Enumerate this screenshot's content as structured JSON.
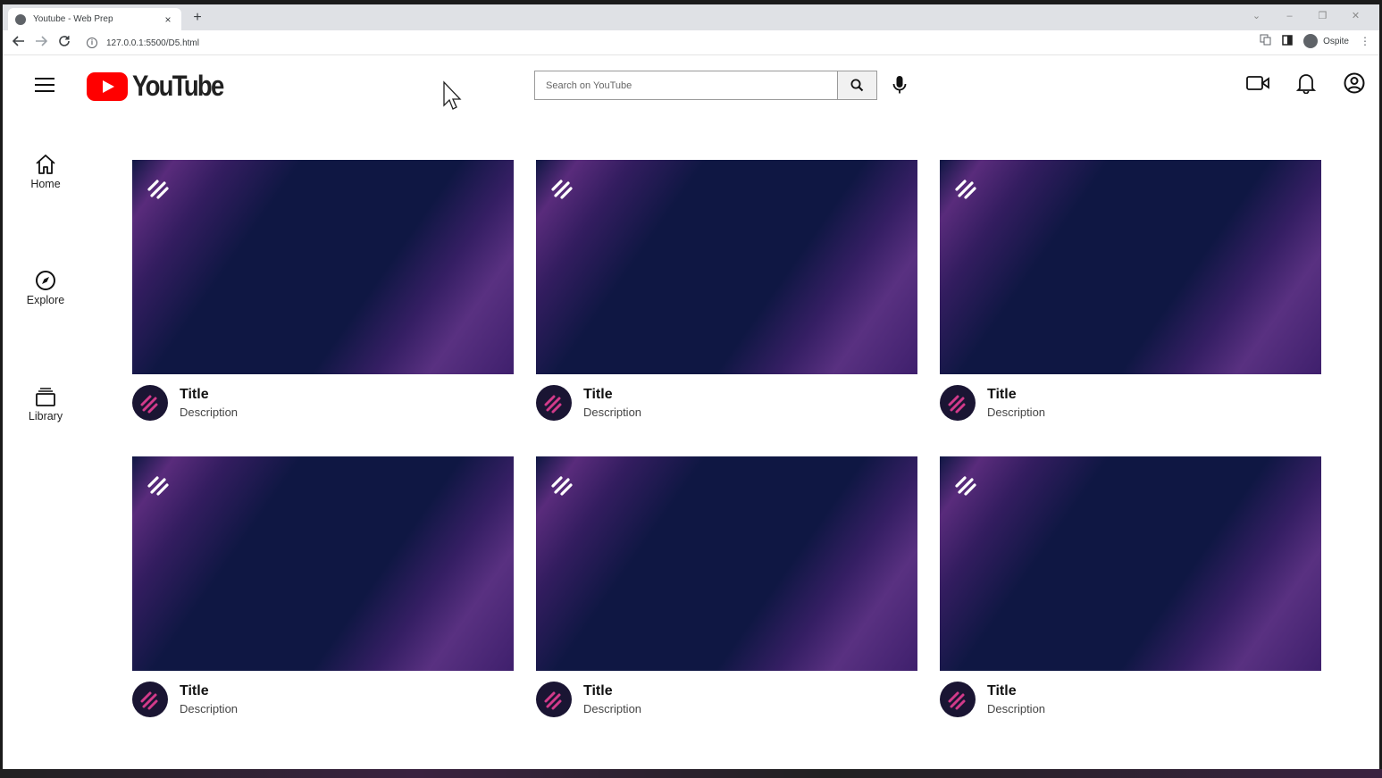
{
  "browser": {
    "tab_title": "Youtube - Web Prep",
    "tab_close": "×",
    "new_tab": "+",
    "url": "127.0.0.1:5500/D5.html",
    "profile_label": "Ospite",
    "window_controls": [
      "⌄",
      "–",
      "❐",
      "✕"
    ]
  },
  "header": {
    "logo_text": "YouTube",
    "search_placeholder": "Search on YouTube"
  },
  "sidebar": {
    "items": [
      {
        "label": "Home",
        "icon": "home-icon"
      },
      {
        "label": "Explore",
        "icon": "compass-icon"
      },
      {
        "label": "Library",
        "icon": "library-icon"
      }
    ]
  },
  "videos": [
    {
      "title": "Title",
      "description": "Description"
    },
    {
      "title": "Title",
      "description": "Description"
    },
    {
      "title": "Title",
      "description": "Description"
    },
    {
      "title": "Title",
      "description": "Description"
    },
    {
      "title": "Title",
      "description": "Description"
    },
    {
      "title": "Title",
      "description": "Description"
    }
  ],
  "colors": {
    "brand_red": "#ff0000",
    "thumb_base": "#0f1743",
    "thumb_accent": "#8e3ca6"
  }
}
